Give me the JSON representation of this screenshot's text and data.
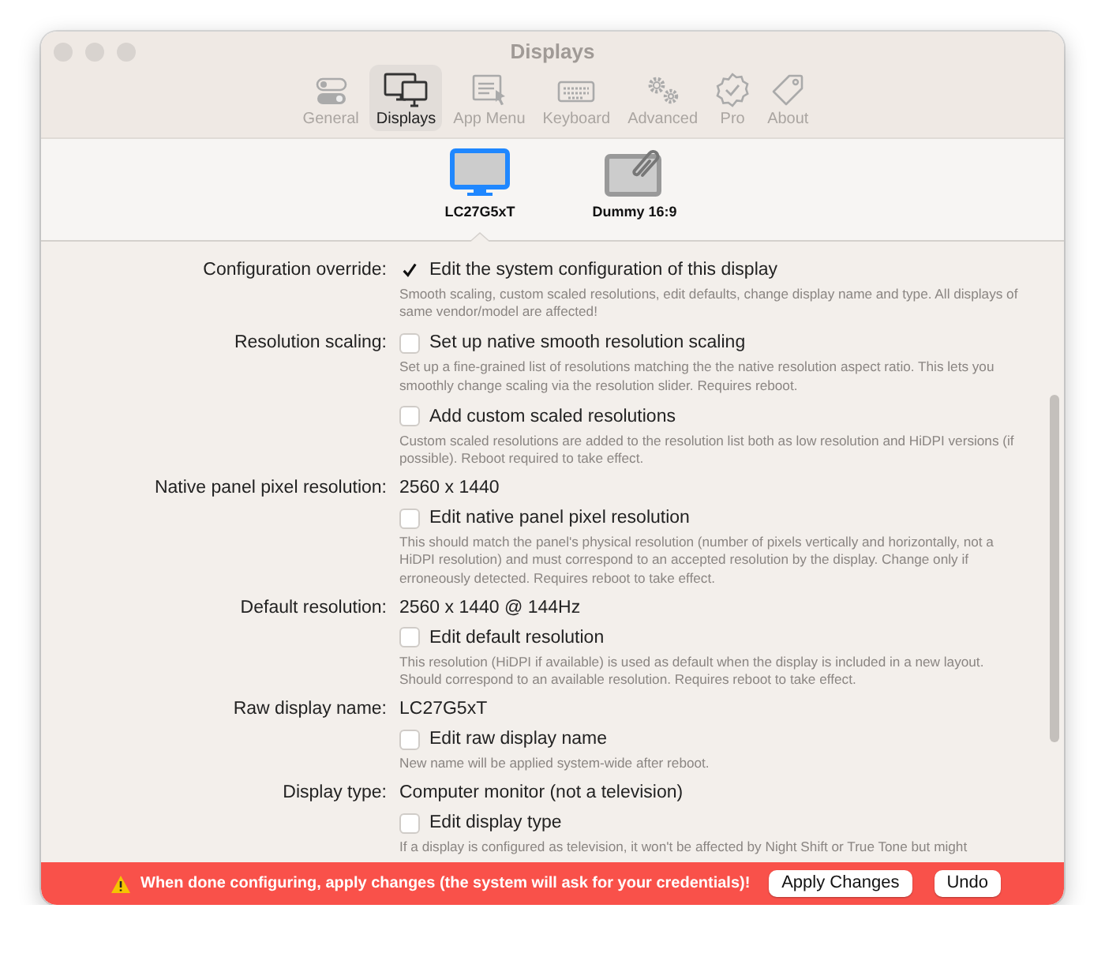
{
  "window": {
    "title": "Displays"
  },
  "tabs": [
    {
      "label": "General",
      "selected": false
    },
    {
      "label": "Displays",
      "selected": true
    },
    {
      "label": "App Menu",
      "selected": false
    },
    {
      "label": "Keyboard",
      "selected": false
    },
    {
      "label": "Advanced",
      "selected": false
    },
    {
      "label": "Pro",
      "selected": false
    },
    {
      "label": "About",
      "selected": false
    }
  ],
  "displays": [
    {
      "name": "LC27G5xT",
      "kind": "monitor",
      "selected": true
    },
    {
      "name": "Dummy 16:9",
      "kind": "dummy",
      "selected": false
    }
  ],
  "settings": [
    {
      "kind": "checkbox",
      "label": "Configuration override:",
      "text": "Edit the system configuration of this display",
      "checked": true,
      "help": "Smooth scaling, custom scaled resolutions, edit defaults, change display name and type. All displays of same vendor/model are affected!"
    },
    {
      "kind": "checkbox",
      "label": "Resolution scaling:",
      "text": "Set up native smooth resolution scaling",
      "checked": false,
      "help": "Set up a fine-grained list of resolutions matching the the native resolution aspect ratio. This lets you smoothly change scaling via the resolution slider. Requires reboot."
    },
    {
      "kind": "checkbox",
      "text": "Add custom scaled resolutions",
      "checked": false,
      "help": "Custom scaled resolutions are added to the resolution list both as low resolution and HiDPI versions (if possible). Reboot required to take effect."
    },
    {
      "kind": "value",
      "label": "Native panel pixel resolution:",
      "text": "2560 x 1440"
    },
    {
      "kind": "checkbox",
      "text": "Edit native panel pixel resolution",
      "checked": false,
      "help": "This should match the panel's physical resolution (number of pixels vertically and horizontally, not a HiDPI resolution) and must correspond to an accepted resolution by the display. Change only if erroneously detected. Requires reboot to take effect."
    },
    {
      "kind": "value",
      "label": "Default resolution:",
      "text": "2560 x 1440 @ 144Hz"
    },
    {
      "kind": "checkbox",
      "text": "Edit default resolution",
      "checked": false,
      "help": "This resolution (HiDPI if available) is used as default when the display is included in a new layout. Should correspond to an available resolution. Requires reboot to take effect."
    },
    {
      "kind": "value",
      "label": "Raw display name:",
      "text": "LC27G5xT"
    },
    {
      "kind": "checkbox",
      "text": "Edit raw display name",
      "checked": false,
      "help": "New name will be applied system-wide after reboot."
    },
    {
      "kind": "value",
      "label": "Display type:",
      "text": "Computer monitor (not a television)"
    },
    {
      "kind": "checkbox",
      "text": "Edit display type",
      "checked": false,
      "help": "If a display is configured as television, it won't be affected by Night Shift or True Tone but might"
    }
  ],
  "footer": {
    "message": "When done configuring, apply changes (the system will ask for your credentials)!",
    "buttons": [
      "Apply Changes",
      "Undo"
    ]
  }
}
